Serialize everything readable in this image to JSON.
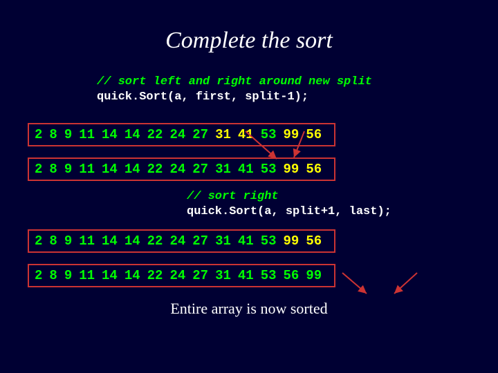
{
  "title": "Complete the sort",
  "code1": {
    "comment": "// sort left and right around new split",
    "call": "quick.Sort(a, first, split-1);"
  },
  "code2": {
    "comment": "// sort right",
    "call": "quick.Sort(a, split+1, last);"
  },
  "rows": {
    "r1": {
      "vals": [
        "2",
        "8",
        "9",
        "11",
        "14",
        "14",
        "22",
        "24",
        "27",
        "31",
        "41",
        "53",
        "99",
        "56"
      ],
      "hl": [
        9,
        10,
        12,
        13
      ]
    },
    "r2": {
      "vals": [
        "2",
        "8",
        "9",
        "11",
        "14",
        "14",
        "22",
        "24",
        "27",
        "31",
        "41",
        "53",
        "99",
        "56"
      ],
      "hl": [
        12,
        13
      ]
    },
    "r3": {
      "vals": [
        "2",
        "8",
        "9",
        "11",
        "14",
        "14",
        "22",
        "24",
        "27",
        "31",
        "41",
        "53",
        "99",
        "56"
      ],
      "hl": [
        12,
        13
      ]
    },
    "r4": {
      "vals": [
        "2",
        "8",
        "9",
        "11",
        "14",
        "14",
        "22",
        "24",
        "27",
        "31",
        "41",
        "53",
        "56",
        "99"
      ],
      "hl": []
    }
  },
  "caption": "Entire array is now sorted"
}
